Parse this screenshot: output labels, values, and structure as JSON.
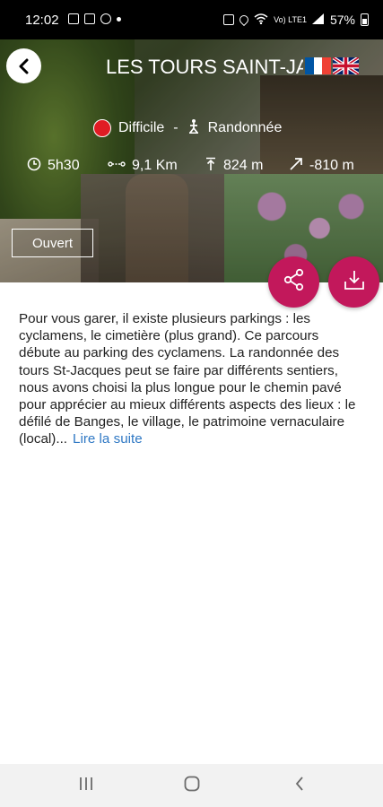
{
  "status_bar": {
    "time": "12:02",
    "carrier": "Vo) LTE1",
    "battery": "57%"
  },
  "trail": {
    "title": "LES TOURS SAINT-JACQUES",
    "difficulty": "Difficile",
    "separator": "-",
    "activity": "Randonnée",
    "duration": "5h30",
    "distance": "9,1 Km",
    "elevation_gain": "824 m",
    "elevation_loss": "-810 m",
    "status": "Ouvert",
    "description": "Pour vous garer, il existe plusieurs parkings : les cyclamens, le cimetière (plus grand). Ce parcours débute au parking des cyclamens. La randonnée des tours St-Jacques peut se faire par différents sentiers, nous avons choisi la plus longue pour le chemin pavé pour apprécier au mieux différents aspects des lieux : le défilé de Banges, le village, le patrimoine vernaculaire (local)...",
    "read_more": "Lire la suite"
  },
  "colors": {
    "accent": "#c2185b",
    "difficulty_red": "#e01c24",
    "link_blue": "#2f78c4"
  },
  "icons": {
    "back": "arrow-left-icon",
    "share": "share-icon",
    "download": "download-icon",
    "clock": "clock-icon",
    "distance": "distance-icon",
    "elevation_gain": "elevation-up-icon",
    "elevation_loss": "elevation-down-icon",
    "hike": "hiker-icon",
    "flag_fr": "flag-france-icon",
    "flag_uk": "flag-uk-icon"
  }
}
